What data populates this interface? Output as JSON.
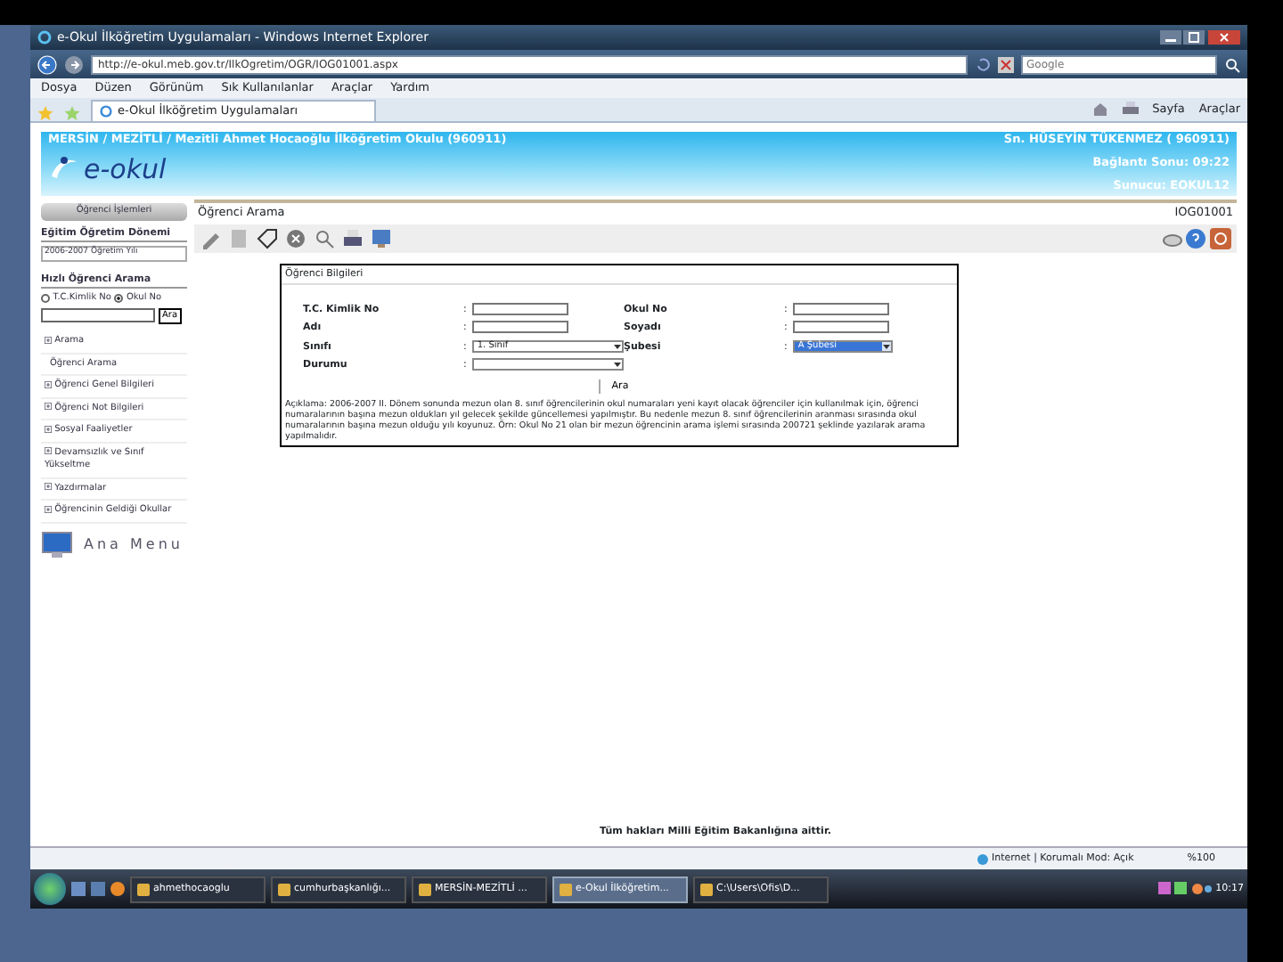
{
  "window": {
    "title": "e-Okul İlköğretim Uygulamaları - Windows Internet Explorer"
  },
  "address_bar": {
    "url": "http://e-okul.meb.gov.tr/IlkOgretim/OGR/IOG01001.aspx",
    "search_placeholder": "Google"
  },
  "menu": [
    "Dosya",
    "Düzen",
    "Görünüm",
    "Sık Kullanılanlar",
    "Araçlar",
    "Yardım"
  ],
  "tab": {
    "label": "e-Okul İlköğretim Uygulamaları"
  },
  "command_bar": [
    "Sayfa",
    "Araçlar"
  ],
  "header": {
    "logo": "e-okul",
    "location": "MERSİN / MEZİTLİ / Mezitli Ahmet Hocaoğlu İlköğretim Okulu (960911)",
    "user": "Sn. HÜSEYİN TÜKENMEZ ( 960911)",
    "connection": "Bağlantı Sonu: 09:22",
    "server": "Sunucu: EOKUL12"
  },
  "sidebar": {
    "title": "Öğrenci İşlemleri",
    "term_label": "Eğitim Öğretim Dönemi",
    "term_value": "2006-2007 Öğretim Yılı",
    "quick_search_title": "Hızlı Öğrenci Arama",
    "radios": [
      {
        "label": "T.C.Kimlik No",
        "selected": false
      },
      {
        "label": "Okul No",
        "selected": true
      }
    ],
    "search_button": "Ara",
    "items": [
      {
        "label": "Arama",
        "kind": "group"
      },
      {
        "label": "Öğrenci Arama",
        "kind": "item"
      },
      {
        "label": "Öğrenci Genel Bilgileri",
        "kind": "group"
      },
      {
        "label": "Öğrenci Not Bilgileri",
        "kind": "group"
      },
      {
        "label": "Sosyal Faaliyetler",
        "kind": "group"
      },
      {
        "label": "Devamsızlık ve Sınıf Yükseltme",
        "kind": "group"
      },
      {
        "label": "Yazdırmalar",
        "kind": "group"
      },
      {
        "label": "Öğrencinin Geldiği Okullar",
        "kind": "group"
      }
    ],
    "main_menu": "Ana Menu"
  },
  "content": {
    "title": "Öğrenci Arama",
    "code": "IOG01001",
    "legend": "Öğrenci Bilgileri",
    "fields": [
      {
        "label": "T.C. Kimlik No",
        "separator": ":",
        "kind": "text"
      },
      {
        "label": "Okul No",
        "separator": ":",
        "kind": "text"
      },
      {
        "label": "Adı",
        "separator": ":",
        "kind": "text"
      },
      {
        "label": "Soyadı",
        "separator": ":",
        "kind": "text"
      },
      {
        "label": "Sınıfı",
        "separator": ":",
        "kind": "select",
        "value": "1. Sınıf",
        "highlighted": false
      },
      {
        "label": "Şubesi",
        "separator": ":",
        "kind": "select",
        "value": "A Şubesi",
        "highlighted": true
      },
      {
        "label": "Durumu",
        "separator": ":",
        "kind": "select",
        "highlighted": false
      }
    ],
    "search_button": "Ara",
    "note": "Açıklama: 2006-2007 II. Dönem sonunda mezun olan 8. sınıf öğrencilerinin okul numaraları yeni kayıt olacak öğrenciler için kullanılmak için, öğrenci numaralarının başına mezun oldukları yıl gelecek şekilde güncellemesi yapılmıştır. Bu nedenle mezun 8. sınıf öğrencilerinin aranması sırasında okul numaralarının başına mezun olduğu yılı koyunuz. Örn: Okul No 21 olan bir mezun öğrencinin arama işlemi sırasında 200721 şeklinde yazılarak arama yapılmalıdır."
  },
  "footer": "Tüm hakları Milli Eğitim Bakanlığına aittir.",
  "status_bar": {
    "zone": "Internet | Korumalı Mod: Açık",
    "zoom": "%100"
  },
  "taskbar": {
    "items": [
      {
        "label": "ahmethocaoglu",
        "selected": false
      },
      {
        "label": "cumhurbaşkanlığı...",
        "selected": false
      },
      {
        "label": "MERSİN-MEZİTLİ ...",
        "selected": false
      },
      {
        "label": "e-Okul İlköğretim...",
        "selected": true
      },
      {
        "label": "C:\\Users\\Ofis\\D...",
        "selected": false
      }
    ],
    "clock": "10:17"
  }
}
